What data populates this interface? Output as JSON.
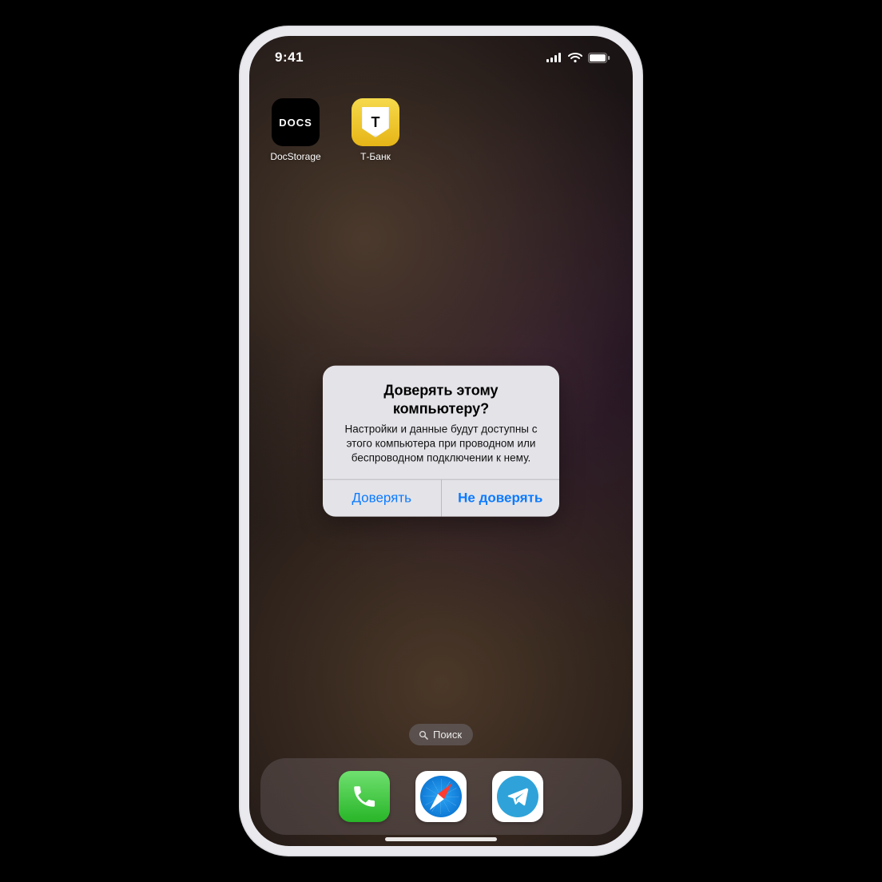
{
  "status": {
    "time": "9:41"
  },
  "home": {
    "apps": [
      {
        "label": "DocStorage",
        "icon_text": "DOCS"
      },
      {
        "label": "Т‑Банк",
        "icon_text": "T"
      }
    ],
    "search_label": "Поиск"
  },
  "alert": {
    "title": "Доверять этому компьютеру?",
    "message": "Настройки и данные будут доступны с этого компьютера при проводном или беспроводном подключении к нему.",
    "trust_label": "Доверять",
    "dont_trust_label": "Не доверять"
  },
  "dock": {
    "items": [
      "phone",
      "safari",
      "telegram"
    ]
  }
}
